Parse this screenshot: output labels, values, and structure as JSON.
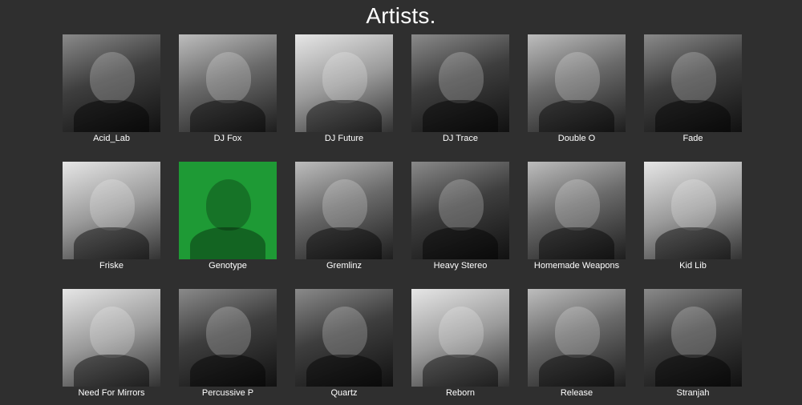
{
  "page": {
    "title": "Artists."
  },
  "artists": [
    {
      "name": "Acid_Lab"
    },
    {
      "name": "DJ Fox"
    },
    {
      "name": "DJ Future"
    },
    {
      "name": "DJ Trace"
    },
    {
      "name": "Double O"
    },
    {
      "name": "Fade"
    },
    {
      "name": "Friske"
    },
    {
      "name": "Genotype",
      "highlighted": true
    },
    {
      "name": "Gremlinz"
    },
    {
      "name": "Heavy Stereo"
    },
    {
      "name": "Homemade Weapons"
    },
    {
      "name": "Kid Lib"
    },
    {
      "name": "Need For Mirrors"
    },
    {
      "name": "Percussive P"
    },
    {
      "name": "Quartz"
    },
    {
      "name": "Reborn"
    },
    {
      "name": "Release"
    },
    {
      "name": "Stranjah"
    }
  ],
  "colors": {
    "background": "#2f2f2f",
    "highlight": "#1e9a35",
    "text": "#ffffff"
  }
}
